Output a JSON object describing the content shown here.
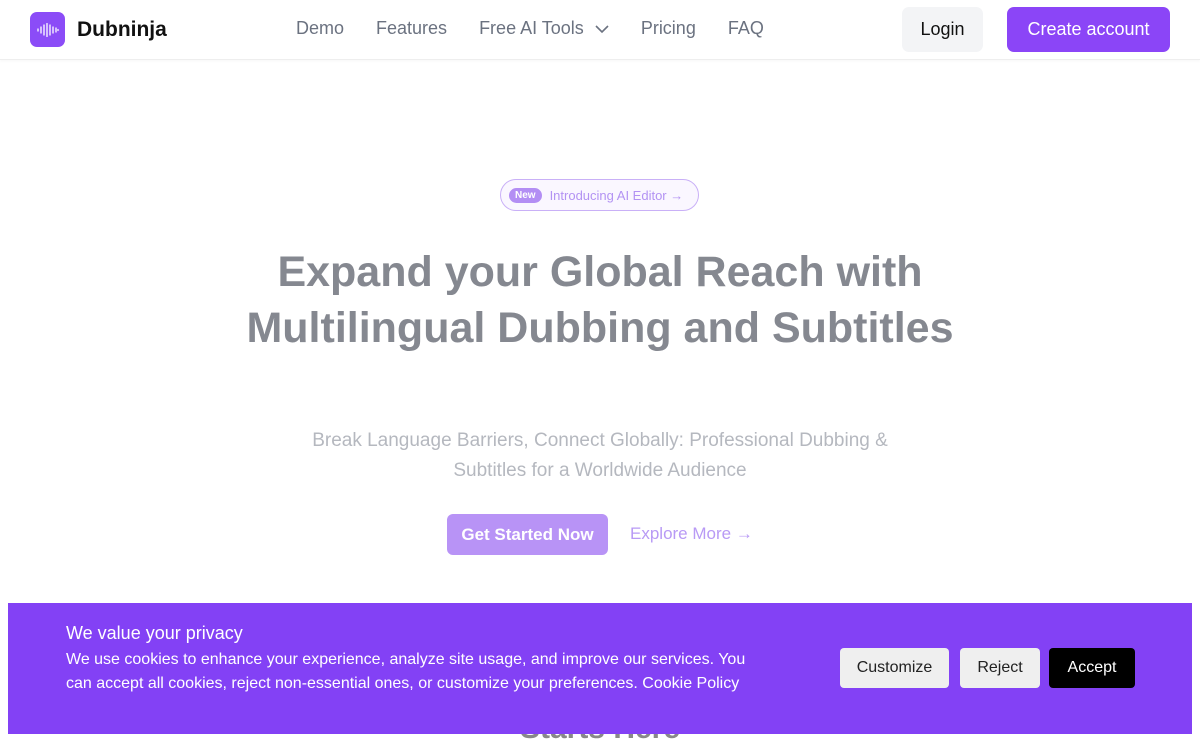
{
  "header": {
    "brand": "Dubninja",
    "links": [
      "Demo",
      "Features",
      "Free AI Tools",
      "Pricing",
      "FAQ"
    ],
    "login": "Login",
    "create_account": "Create account"
  },
  "hero": {
    "badge": "New",
    "announcement": "Introducing AI Editor →",
    "title": "Expand your Global Reach with Multilingual Dubbing and Subtitles",
    "subtitle": "Break Language Barriers, Connect Globally: Professional Dubbing & Subtitles for a Worldwide Audience",
    "cta": "Get Started Now",
    "explore": "Explore More →",
    "next_heading": "Starts Here"
  },
  "cookie": {
    "title": "We value your privacy",
    "body": "We use cookies to enhance your experience, analyze site usage, and improve our services. You can accept all cookies, reject non-essential ones, or customize your preferences. Cookie Policy",
    "customize": "Customize",
    "reject": "Reject",
    "accept": "Accept"
  },
  "colors": {
    "brand": "#8b45f7",
    "cookie_bg": "#8341f5"
  }
}
